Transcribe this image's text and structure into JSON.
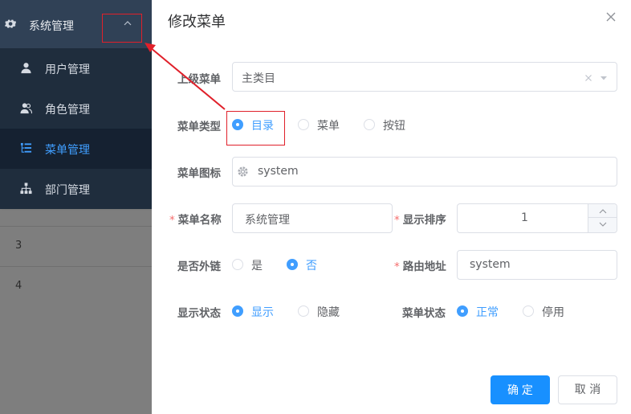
{
  "background_table": {
    "rows": [
      "3",
      "4"
    ]
  },
  "sidebar": {
    "header": {
      "title": "系统管理"
    },
    "items": [
      {
        "label": "用户管理",
        "icon": "user-icon"
      },
      {
        "label": "角色管理",
        "icon": "users-icon"
      },
      {
        "label": "菜单管理",
        "icon": "tree-table-icon",
        "active": true
      },
      {
        "label": "部门管理",
        "icon": "org-tree-icon"
      }
    ]
  },
  "dialog": {
    "title": "修改菜单",
    "parent_menu": {
      "label": "上级菜单",
      "value": "主类目"
    },
    "menu_type": {
      "label": "菜单类型",
      "options": [
        "目录",
        "菜单",
        "按钮"
      ],
      "selected": "目录"
    },
    "menu_icon": {
      "label": "菜单图标",
      "value": "system"
    },
    "menu_name": {
      "label": "菜单名称",
      "value": "系统管理"
    },
    "order": {
      "label": "显示排序",
      "value": "1"
    },
    "external_link": {
      "label": "是否外链",
      "options": [
        "是",
        "否"
      ],
      "selected": "否"
    },
    "route_path": {
      "label": "路由地址",
      "value": "system"
    },
    "visible": {
      "label": "显示状态",
      "options": [
        "显示",
        "隐藏"
      ],
      "selected": "显示"
    },
    "status": {
      "label": "菜单状态",
      "options": [
        "正常",
        "停用"
      ],
      "selected": "正常"
    },
    "confirm_label": "确 定",
    "cancel_label": "取 消"
  },
  "colors": {
    "primary": "#1890ff",
    "annotation": "#e0202a",
    "sidebar_bg": "#1f2d3d"
  }
}
